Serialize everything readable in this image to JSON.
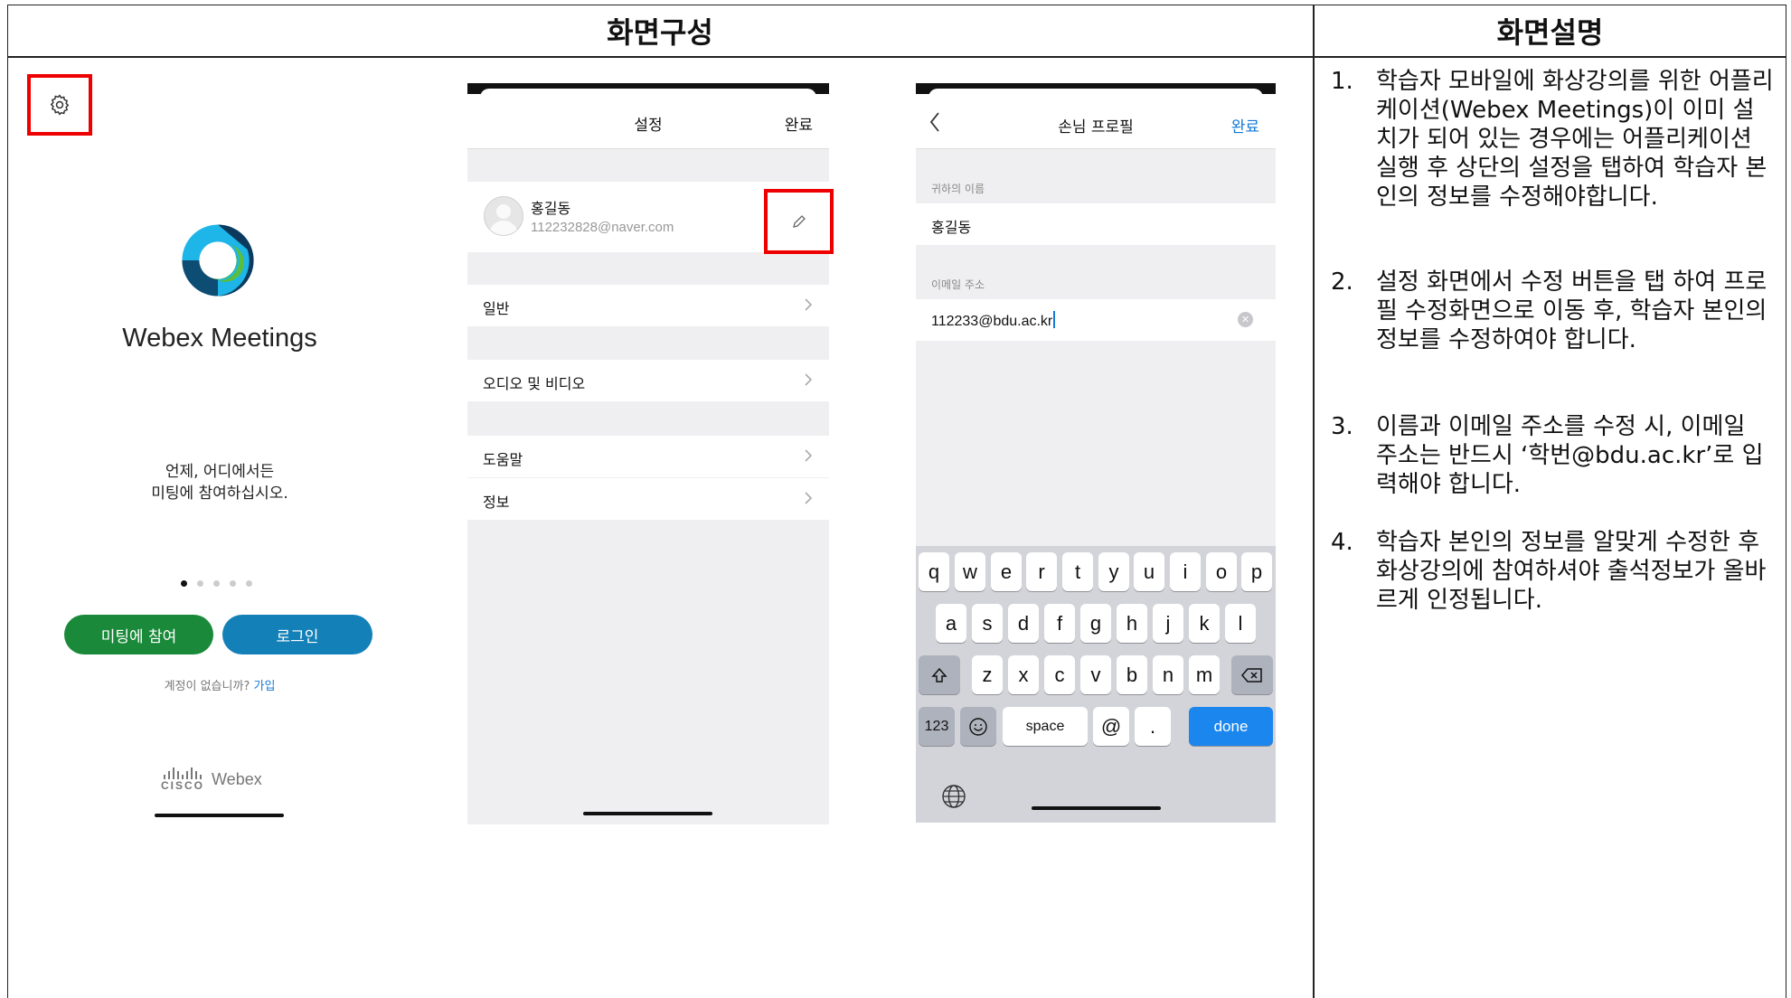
{
  "table": {
    "header_left": "화면구성",
    "header_right": "화면설명"
  },
  "screen1": {
    "settings_icon": "gear-icon",
    "app_name": "Webex Meetings",
    "tagline_line1": "언제, 어디에서든",
    "tagline_line2": "미팅에 참여하십시오.",
    "page_dots": 5,
    "active_dot": 1,
    "join_button": "미팅에 참여",
    "login_button": "로그인",
    "no_account_text": "계정이 없습니까?",
    "signup_link": "가입",
    "footer_cisco": "CISCO",
    "footer_webex": "Webex",
    "colors": {
      "join": "#1a8a3a",
      "login": "#1480b8",
      "highlight": "#ee0000"
    }
  },
  "screen2": {
    "title": "설정",
    "done": "완료",
    "profile_name": "홍길동",
    "profile_email": "112232828@naver.com",
    "edit_icon": "pencil-icon",
    "menu": [
      {
        "label": "일반"
      },
      {
        "label": "오디오 및 비디오"
      },
      {
        "label": "도움말"
      },
      {
        "label": "정보"
      }
    ]
  },
  "screen3": {
    "title": "손님 프로필",
    "done": "완료",
    "name_label": "귀하의 이름",
    "name_value": "홍길동",
    "email_label": "이메일 주소",
    "email_value": "112233@bdu.ac.kr",
    "keyboard": {
      "row1": [
        "q",
        "w",
        "e",
        "r",
        "t",
        "y",
        "u",
        "i",
        "o",
        "p"
      ],
      "row2": [
        "a",
        "s",
        "d",
        "f",
        "g",
        "h",
        "j",
        "k",
        "l"
      ],
      "row3": [
        "z",
        "x",
        "c",
        "v",
        "b",
        "n",
        "m"
      ],
      "numbers_key": "123",
      "space_key": "space",
      "at_key": "@",
      "dot_key": ".",
      "done_key": "done"
    }
  },
  "description": [
    {
      "num": "1.",
      "text": "학습자 모바일에 화상강의를 위한 어플리케이션(Webex Meetings)이 이미 설치가 되어 있는 경우에는 어플리케이션 실행 후 상단의 설정을 탭하여 학습자 본인의 정보를 수정해야합니다."
    },
    {
      "num": "2.",
      "text": "설정 화면에서 수정 버튼을 탭 하여 프로필 수정화면으로 이동 후, 학습자 본인의 정보를 수정하여야 합니다."
    },
    {
      "num": "3.",
      "text": "이름과 이메일 주소를 수정 시, 이메일 주소는 반드시 ‘학번@bdu.ac.kr’로 입력해야 합니다."
    },
    {
      "num": "4.",
      "text": "학습자 본인의 정보를 알맞게 수정한 후 화상강의에 참여하셔야 출석정보가 올바르게 인정됩니다."
    }
  ]
}
